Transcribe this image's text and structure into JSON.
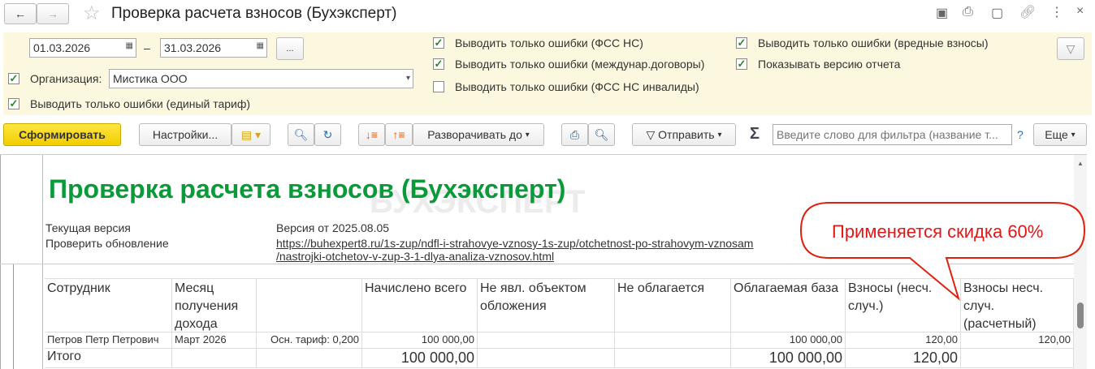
{
  "window": {
    "title": "Проверка расчета взносов (Бухэксперт)"
  },
  "filters": {
    "date_from": "01.03.2026",
    "date_sep": "–",
    "date_to": "31.03.2026",
    "more": "...",
    "org_label": "Организация:",
    "org_value": "Мистика ООО",
    "checks": [
      {
        "label": "Выводить только ошибки (единый тариф)",
        "checked": true
      },
      {
        "label": "Выводить только ошибки (ФСС НС)",
        "checked": true
      },
      {
        "label": "Выводить только ошибки (междунар.договоры)",
        "checked": true
      },
      {
        "label": "Выводить только ошибки (ФСС НС инвалиды)",
        "checked": false
      },
      {
        "label": "Выводить только ошибки (вредные взносы)",
        "checked": true
      },
      {
        "label": "Показывать версию отчета",
        "checked": true
      }
    ]
  },
  "toolbar": {
    "generate": "Сформировать",
    "settings": "Настройки...",
    "expand": "Разворачивать до",
    "send": "Отправить",
    "sigma": "Σ",
    "filter_placeholder": "Введите слово для фильтра (название т...",
    "help": "?",
    "more": "Еще"
  },
  "report": {
    "title": "Проверка расчета взносов (Бухэксперт)",
    "watermark": "БУХЭКСПЕРТ",
    "version_label": "Текущая версия",
    "version_value": "Версия от 2025.08.05",
    "update_label": "Проверить обновление",
    "update_link1": "https://buhexpert8.ru/1s-zup/ndfl-i-strahovye-vznosy-1s-zup/otchetnost-po-strahovym-vznosam",
    "update_link2": "/nastrojki-otchetov-v-zup-3-1-dlya-analiza-vznosov.html",
    "callout": "Применяется скидка 60%",
    "columns": [
      "Сотрудник",
      "Месяц получения дохода",
      "",
      "Начислено всего",
      "Не явл. объектом обложения",
      "Не облагается",
      "Облагаемая база",
      "Взносы (несч. случ.)",
      "Взносы несч. случ. (расчетный)"
    ],
    "rows": [
      [
        "Петров Петр Петрович",
        "Март 2026",
        "Осн. тариф: 0,200",
        "100 000,00",
        "",
        "",
        "100 000,00",
        "120,00",
        "120,00"
      ]
    ],
    "total": [
      "Итого",
      "",
      "",
      "100 000,00",
      "",
      "",
      "100 000,00",
      "120,00",
      ""
    ]
  }
}
